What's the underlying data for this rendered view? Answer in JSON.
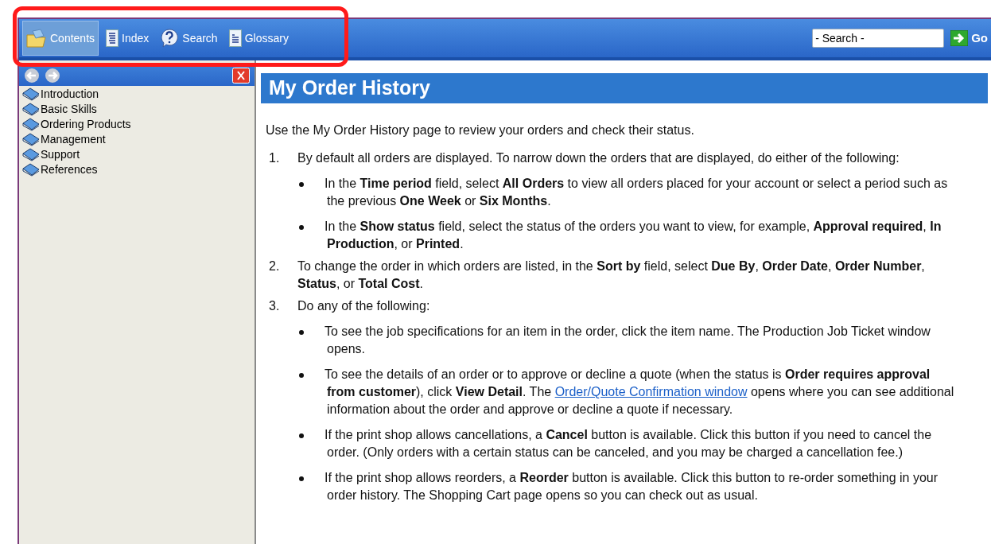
{
  "toolbar": {
    "tabs": [
      {
        "label": "Contents",
        "kind": "folder",
        "selected": true
      },
      {
        "label": "Index",
        "kind": "index",
        "selected": false
      },
      {
        "label": "Search",
        "kind": "help",
        "selected": false
      },
      {
        "label": "Glossary",
        "kind": "glossary",
        "selected": false
      }
    ],
    "search": {
      "placeholder": "- Search -"
    },
    "go_button": "Go"
  },
  "sidebar": {
    "items": [
      {
        "label": "Introduction"
      },
      {
        "label": "Basic Skills"
      },
      {
        "label": "Ordering Products"
      },
      {
        "label": "Management"
      },
      {
        "label": "Support"
      },
      {
        "label": "References"
      }
    ]
  },
  "content": {
    "title": "My Order History",
    "intro": "Use the My Order History page to review your orders and check their status.",
    "steps": [
      {
        "number": "1.",
        "text": [
          {
            "text": "By default all orders are displayed. To narrow down the orders that are displayed, do either of the following:"
          }
        ],
        "bullets": [
          [
            {
              "text": "In the **Time period** field, select **All Orders** to view all orders placed for your account or select a period such as the previous **One Week** or **Six Months**."
            }
          ],
          [
            {
              "text": "In the **Show status** field, select the status of the orders you want to view, for example, **Approval required**, **In Production**, or **Printed**."
            }
          ]
        ]
      },
      {
        "number": "2.",
        "text": [
          {
            "text": "To change the order in which orders are listed, in the **Sort by** field, select **Due By**, **Order Date**, **Order Number**, **Status**, or **Total Cost**."
          }
        ]
      },
      {
        "number": "3.",
        "text": [
          {
            "text": "Do any of the following:"
          }
        ],
        "bullets": [
          [
            {
              "text": "To see the job specifications for an item in the order, click the item name. The Production Job Ticket window opens."
            }
          ],
          [
            {
              "text": "To see the details of an order or to approve or decline a quote (when the status is **Order requires approval from customer**), click **View Detail**. The "
            },
            {
              "text": "Order/Quote Confirmation window",
              "kind": "link"
            },
            {
              "text": " opens where you can see additional information about the order and approve or decline a quote if necessary."
            }
          ],
          [
            {
              "text": "If the print shop allows cancellations, a **Cancel** button is available. Click this button if you need to cancel the order. (Only orders with a certain status can be canceled, and you may be charged a cancellation fee.)"
            }
          ],
          [
            {
              "text": "If the print shop allows reorders, a **Reorder** button is available. Click this button to re-order something in your order history. The Shopping Cart page opens so you can check out as usual."
            }
          ]
        ]
      }
    ]
  },
  "annotation": {
    "kind": "highlight-box"
  }
}
